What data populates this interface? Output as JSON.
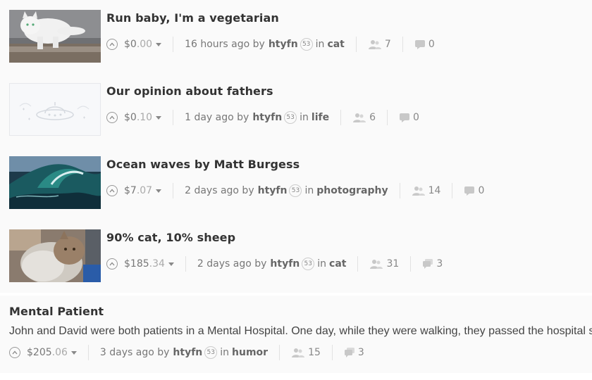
{
  "posts": [
    {
      "title": "Run baby, I'm a vegetarian",
      "payout_dollars": "$0",
      "payout_cents": ".00",
      "time": "16 hours ago by",
      "author": "htyfn",
      "reputation": "53",
      "in_label": "in",
      "category": "cat",
      "voters": "7",
      "comments": "0",
      "thumb_icon": "cat-photo"
    },
    {
      "title": "Our opinion about fathers",
      "payout_dollars": "$0",
      "payout_cents": ".10",
      "time": "1 day ago by",
      "author": "htyfn",
      "reputation": "53",
      "in_label": "in",
      "category": "life",
      "voters": "6",
      "comments": "0",
      "thumb_icon": "ufo-placeholder"
    },
    {
      "title": "Ocean waves by Matt Burgess",
      "payout_dollars": "$7",
      "payout_cents": ".07",
      "time": "2 days ago by",
      "author": "htyfn",
      "reputation": "53",
      "in_label": "in",
      "category": "photography",
      "voters": "14",
      "comments": "0",
      "thumb_icon": "wave-photo"
    },
    {
      "title": "90% cat, 10% sheep",
      "payout_dollars": "$185",
      "payout_cents": ".34",
      "time": "2 days ago by",
      "author": "htyfn",
      "reputation": "53",
      "in_label": "in",
      "category": "cat",
      "voters": "31",
      "comments": "3",
      "thumb_icon": "fluffy-cat-photo"
    }
  ],
  "text_post": {
    "title": "Mental Patient",
    "excerpt": "John and David were both patients in a Mental Hospital. One day, while they were walking, they passed the hospital swimming pool",
    "payout_dollars": "$205",
    "payout_cents": ".06",
    "time": "3 days ago by",
    "author": "htyfn",
    "reputation": "53",
    "in_label": "in",
    "category": "humor",
    "voters": "15",
    "comments": "3"
  },
  "icons": {
    "upvote": "chevron-up-circle-icon",
    "dropdown": "caret-down-icon",
    "voters": "users-icon",
    "comments": "chat-bubble-icon"
  },
  "colors": {
    "muted_text": "#777777",
    "cents": "#aaaaaa",
    "title": "#333333"
  }
}
